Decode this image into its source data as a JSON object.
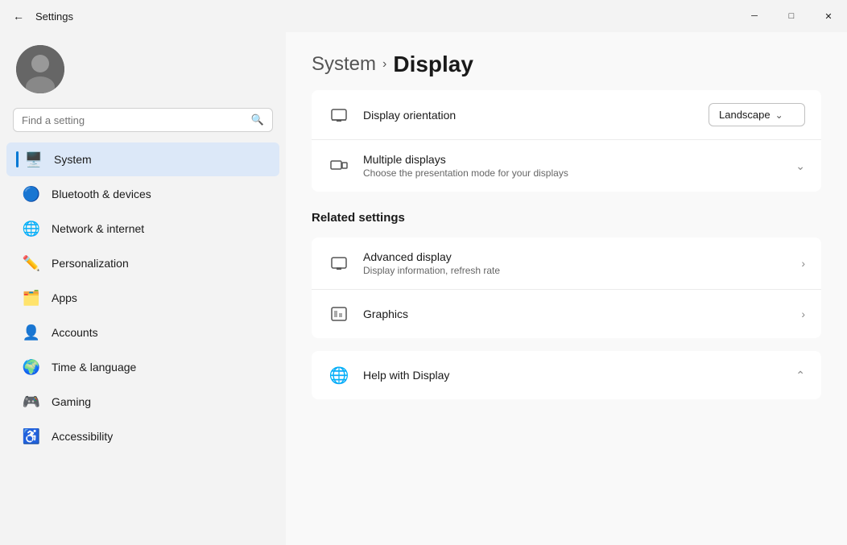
{
  "window": {
    "title": "Settings",
    "minimize_label": "─",
    "maximize_label": "□",
    "close_label": "✕"
  },
  "search": {
    "placeholder": "Find a setting"
  },
  "breadcrumb": {
    "parent": "System",
    "current": "Display"
  },
  "sidebar": {
    "nav_items": [
      {
        "id": "system",
        "label": "System",
        "icon": "🖥️",
        "active": true
      },
      {
        "id": "bluetooth",
        "label": "Bluetooth & devices",
        "icon": "🔵",
        "active": false
      },
      {
        "id": "network",
        "label": "Network & internet",
        "icon": "🌐",
        "active": false
      },
      {
        "id": "personalization",
        "label": "Personalization",
        "icon": "✏️",
        "active": false
      },
      {
        "id": "apps",
        "label": "Apps",
        "icon": "🗂️",
        "active": false
      },
      {
        "id": "accounts",
        "label": "Accounts",
        "icon": "👤",
        "active": false
      },
      {
        "id": "time",
        "label": "Time & language",
        "icon": "🌍",
        "active": false
      },
      {
        "id": "gaming",
        "label": "Gaming",
        "icon": "🎮",
        "active": false
      },
      {
        "id": "accessibility",
        "label": "Accessibility",
        "icon": "♿",
        "active": false
      }
    ]
  },
  "main": {
    "settings": [
      {
        "id": "orientation",
        "icon": "🖥️",
        "title": "Display orientation",
        "desc": "",
        "control_type": "dropdown",
        "control_value": "Landscape"
      },
      {
        "id": "multiple-displays",
        "icon": "🖥️",
        "title": "Multiple displays",
        "desc": "Choose the presentation mode for your displays",
        "control_type": "expand",
        "control_value": ""
      }
    ],
    "related_label": "Related settings",
    "related_settings": [
      {
        "id": "advanced-display",
        "icon": "🖥️",
        "title": "Advanced display",
        "desc": "Display information, refresh rate",
        "control_type": "arrow"
      },
      {
        "id": "graphics",
        "icon": "📊",
        "title": "Graphics",
        "desc": "",
        "control_type": "arrow"
      }
    ],
    "help_label": "Help with Display",
    "help_id": "help-display"
  }
}
